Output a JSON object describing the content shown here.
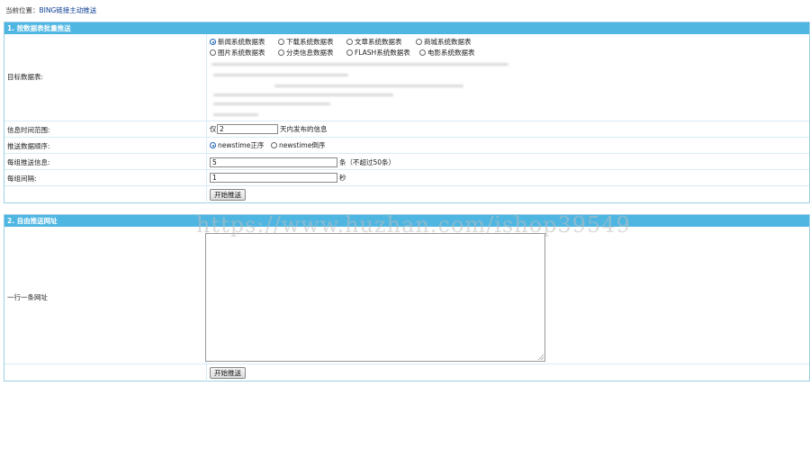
{
  "breadcrumb": {
    "prefix": "当前位置：",
    "link": "BING链接主动推送"
  },
  "section1": {
    "title": "1. 按数据表批量推送",
    "target_label": "目标数据表:",
    "tables_row1": [
      "新闻系统数据表",
      "下载系统数据表",
      "文章系统数据表",
      "商城系统数据表"
    ],
    "tables_row2": [
      "图片系统数据表",
      "分类信息数据表",
      "FLASH系统数据表",
      "电影系统数据表"
    ],
    "selected_table": "新闻系统数据表",
    "time_label": "信息时间范围:",
    "time_prefix": "仅",
    "time_value": "2",
    "time_suffix": "天内发布的信息",
    "order_label": "推送数据顺序:",
    "order_options": [
      "newstime正序",
      "newstime倒序"
    ],
    "order_selected": "newstime正序",
    "group_count_label": "每组推送信息:",
    "group_count_value": "5",
    "group_count_suffix": "条（不超过50条）",
    "interval_label": "每组间隔:",
    "interval_value": "1",
    "interval_suffix": "秒",
    "submit_label": "开始推送"
  },
  "section2": {
    "title": "2. 自由推送网址",
    "urls_label": "一行一条网址",
    "urls_value": "",
    "submit_label": "开始推送"
  },
  "watermark": "https://www.huzhan.com/ishop39549"
}
